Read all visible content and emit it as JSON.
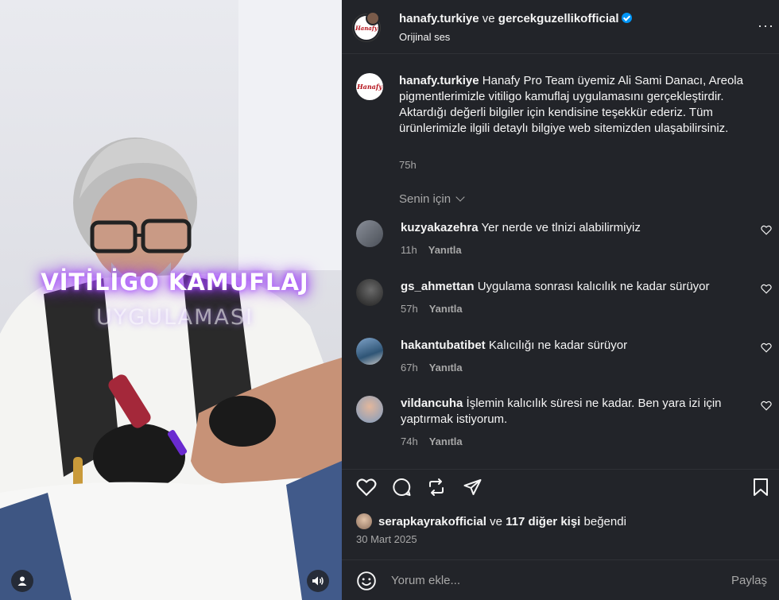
{
  "media": {
    "overlay_line1": "VİTİLİGO KAMUFLAJ",
    "overlay_line2": "UYGULAMASI",
    "user_icon": "user-icon",
    "sound_icon": "speaker-icon"
  },
  "header": {
    "author": "hanafy.turkiye",
    "conjunction": "ve",
    "coauthor": "gercekguzellikofficial",
    "audio": "Orijinal ses",
    "more": "···",
    "avatar_logo": "Hanafy"
  },
  "caption": {
    "username": "hanafy.turkiye",
    "text": "Hanafy Pro Team üyemiz Ali Sami Danacı, Areola pigmentlerimizle vitiligo kamuflaj uygulamasını gerçekleştirdir. Aktardığı değerli bilgiler için kendisine teşekkür ederiz. Tüm ürünlerimizle ilgili detaylı bilgiye web sitemizden ulaşabilirsiniz.",
    "time": "75h"
  },
  "for_you": "Senin için",
  "comments": [
    {
      "username": "kuzyakazehra",
      "text": "Yer nerde ve tlnizi alabilirmiyiz",
      "time": "11h",
      "reply": "Yanıtla"
    },
    {
      "username": "gs_ahmettan",
      "text": "Uygulama sonrası kalıcılık ne kadar sürüyor",
      "time": "57h",
      "reply": "Yanıtla"
    },
    {
      "username": "hakantubatibet",
      "text": "Kalıcılığı ne kadar sürüyor",
      "time": "67h",
      "reply": "Yanıtla"
    },
    {
      "username": "vildancuha",
      "text": "İşlemin kalıcılık süresi ne kadar. Ben yara izi için yaptırmak istiyorum.",
      "time": "74h",
      "reply": "Yanıtla"
    }
  ],
  "likes": {
    "user": "serapkayrakofficial",
    "conjunction": "ve",
    "others": "117 diğer kişi",
    "suffix": "beğendi"
  },
  "date": "30 Mart 2025",
  "composer": {
    "placeholder": "Yorum ekle...",
    "share": "Paylaş"
  },
  "colors": {
    "panel_bg": "#222429",
    "verified": "#0095f6",
    "secondary_text": "#a8a8a8",
    "glow": "#9a3cff"
  }
}
